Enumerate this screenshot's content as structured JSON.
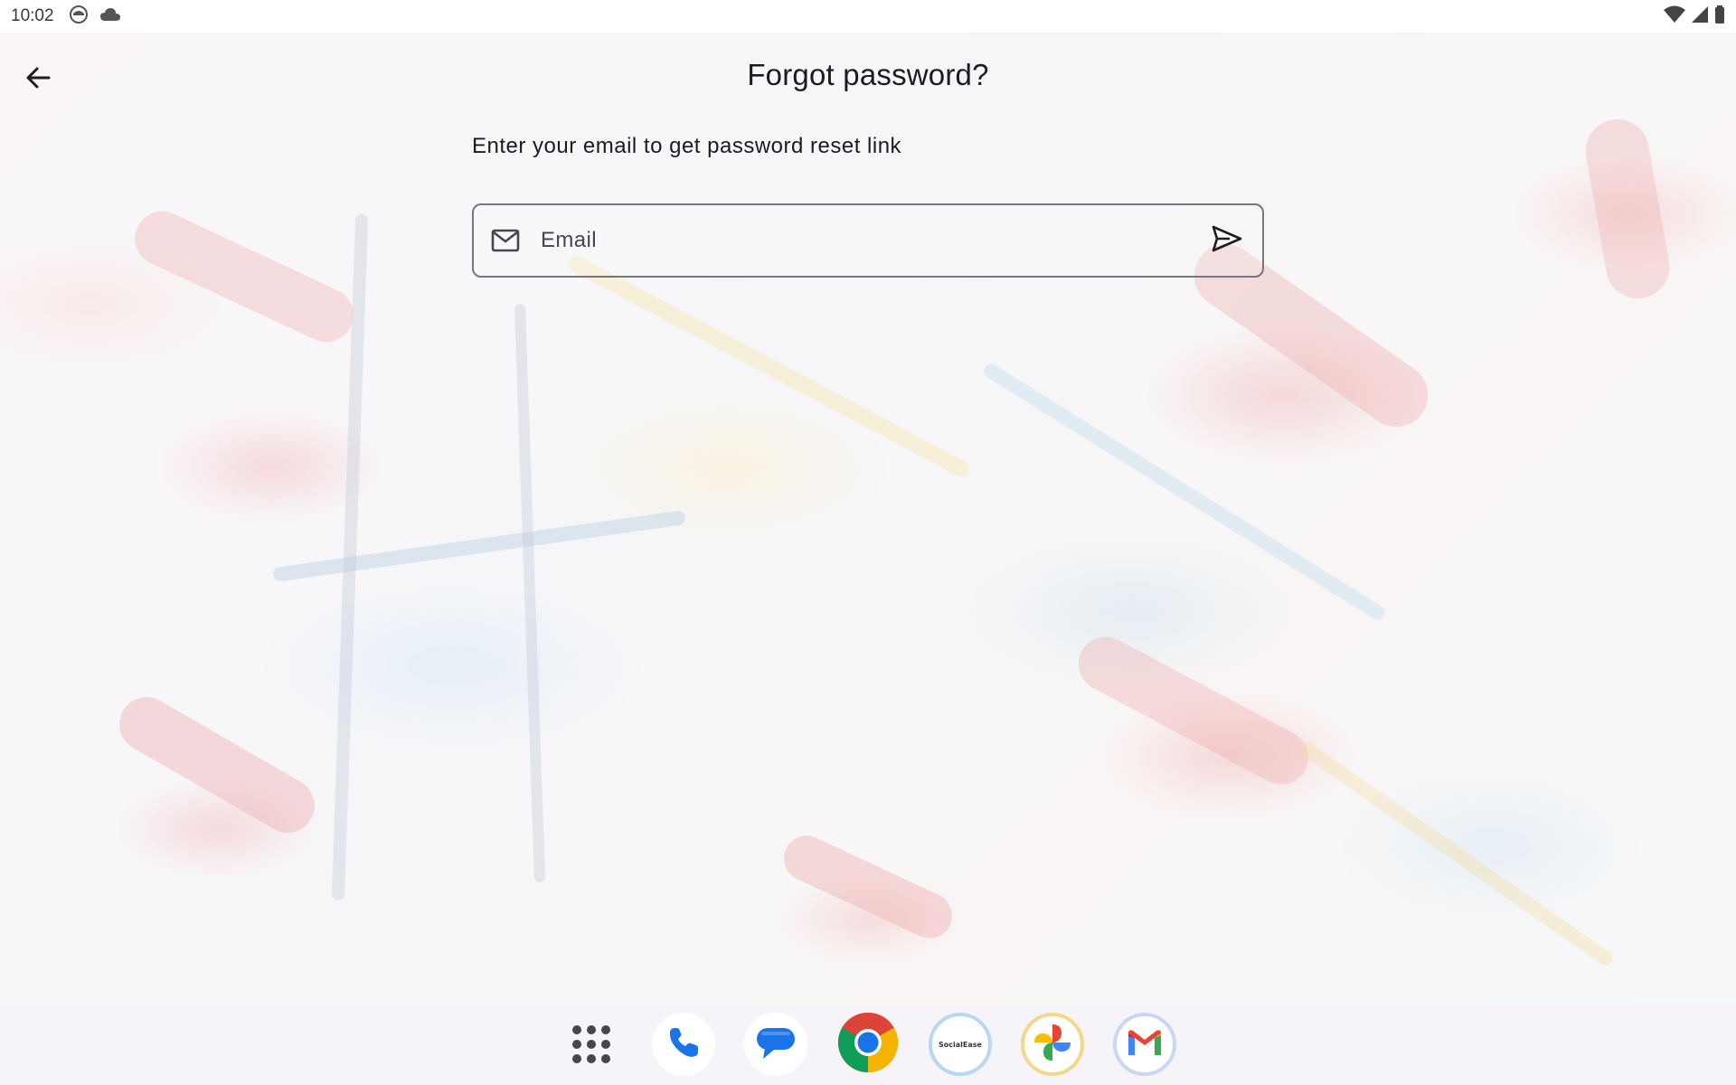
{
  "status_bar": {
    "time": "10:02",
    "left_icons": [
      "face-icon",
      "cloud-icon"
    ],
    "right_icons": [
      "wifi-icon",
      "signal-icon",
      "battery-icon"
    ]
  },
  "header": {
    "back_icon": "arrow-back-icon",
    "title": "Forgot password?"
  },
  "form": {
    "subtitle": "Enter your email to get password reset link",
    "email_placeholder": "Email",
    "email_value": "",
    "leading_icon": "mail-icon",
    "trailing_icon": "send-icon"
  },
  "dock": {
    "apps": [
      {
        "name": "App drawer",
        "icon": "apps-grid-icon"
      },
      {
        "name": "Phone",
        "icon": "phone-icon"
      },
      {
        "name": "Messages",
        "icon": "messages-icon"
      },
      {
        "name": "Chrome",
        "icon": "chrome-icon"
      },
      {
        "name": "SocialEase",
        "icon": "socialease-icon",
        "label": "SocialEase"
      },
      {
        "name": "Photos",
        "icon": "photos-icon"
      },
      {
        "name": "Gmail",
        "icon": "gmail-icon"
      }
    ]
  },
  "colors": {
    "text_primary": "#1d1b20",
    "outline": "#79747e",
    "dock_background": "#f6f4f9"
  }
}
